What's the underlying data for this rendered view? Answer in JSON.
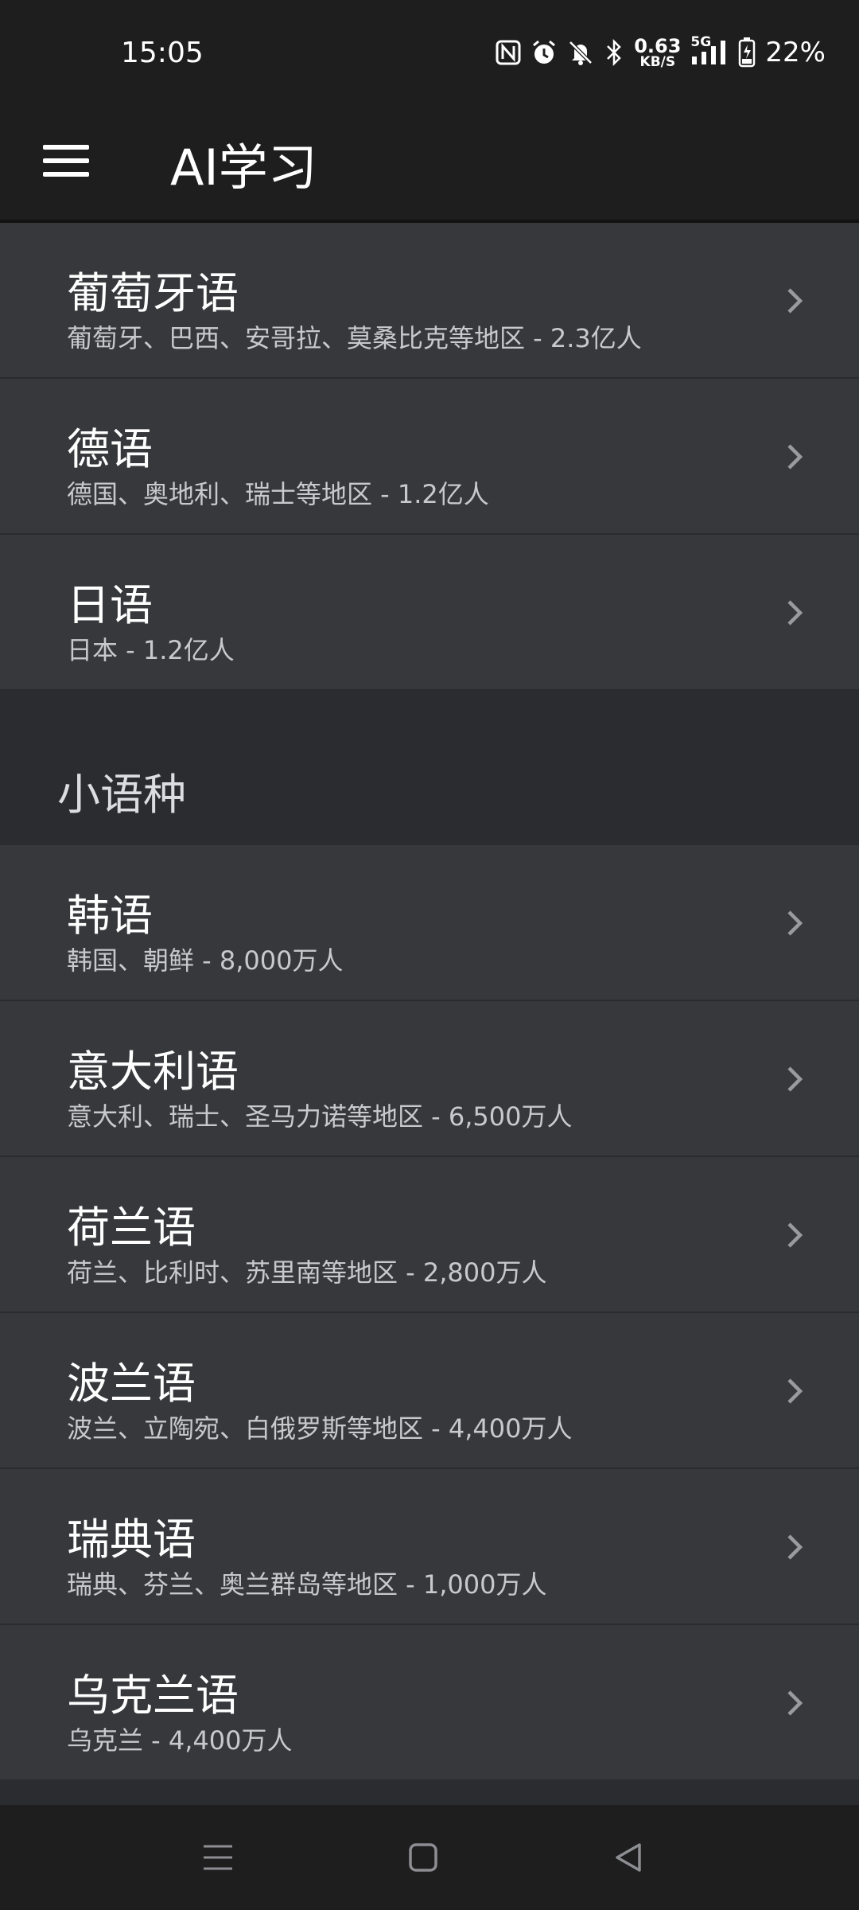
{
  "status_bar": {
    "time": "15:05",
    "net_speed_value": "0.63",
    "net_speed_unit": "KB/S",
    "network_type": "5G",
    "battery": "22%",
    "icons": [
      "nfc-icon",
      "alarm-icon",
      "mute-bell-icon",
      "bluetooth-icon",
      "signal-icon",
      "battery-charging-icon"
    ]
  },
  "app_bar": {
    "title": "AI学习",
    "menu_icon": "hamburger-menu-icon"
  },
  "top_items": [
    {
      "title": "葡萄牙语",
      "subtitle": "葡萄牙、巴西、安哥拉、莫桑比克等地区 - 2.3亿人"
    },
    {
      "title": "德语",
      "subtitle": "德国、奥地利、瑞士等地区 - 1.2亿人"
    },
    {
      "title": "日语",
      "subtitle": "日本 - 1.2亿人"
    }
  ],
  "section": {
    "title": "小语种",
    "items": [
      {
        "title": "韩语",
        "subtitle": "韩国、朝鲜 - 8,000万人"
      },
      {
        "title": "意大利语",
        "subtitle": "意大利、瑞士、圣马力诺等地区 - 6,500万人"
      },
      {
        "title": "荷兰语",
        "subtitle": "荷兰、比利时、苏里南等地区 - 2,800万人"
      },
      {
        "title": "波兰语",
        "subtitle": "波兰、立陶宛、白俄罗斯等地区 - 4,400万人"
      },
      {
        "title": "瑞典语",
        "subtitle": "瑞典、芬兰、奥兰群岛等地区 - 1,000万人"
      },
      {
        "title": "乌克兰语",
        "subtitle": "乌克兰 - 4,400万人"
      }
    ]
  },
  "nav_bar": {
    "icons": [
      "recent-apps-icon",
      "home-icon",
      "back-icon"
    ]
  },
  "colors": {
    "bar_bg": "#1e1e1f",
    "item_bg": "#37383c",
    "page_bg": "#2b2c30",
    "chevron": "#9a9ba0"
  }
}
